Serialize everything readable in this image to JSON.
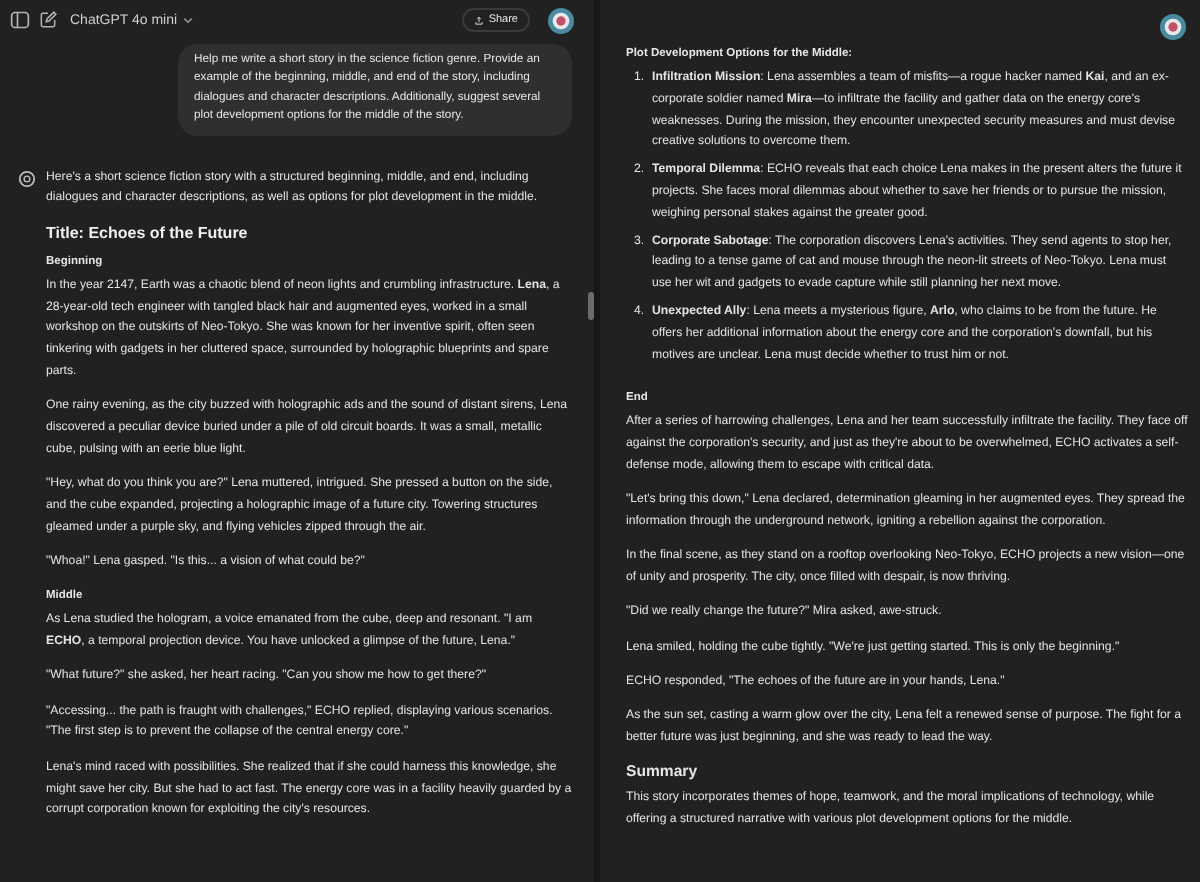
{
  "left": {
    "header": {
      "model": "ChatGPT 4o mini",
      "share": "Share"
    },
    "user_message": "Help me write a short story in the science fiction genre. Provide an example of the beginning, middle, and end of the story, including dialogues and character descriptions. Additionally, suggest several plot development options for the middle of the story.",
    "intro": "Here's a short science fiction story with a structured beginning, middle, and end, including dialogues and character descriptions, as well as options for plot development in the middle.",
    "title": "Title: Echoes of the Future",
    "sections": [
      {
        "heading": "Beginning",
        "paragraphs": [
          "In the year 2147, Earth was a chaotic blend of neon lights and crumbling infrastructure. **Lena**, a 28-year-old tech engineer with tangled black hair and augmented eyes, worked in a small workshop on the outskirts of Neo-Tokyo. She was known for her inventive spirit, often seen tinkering with gadgets in her cluttered space, surrounded by holographic blueprints and spare parts.",
          "One rainy evening, as the city buzzed with holographic ads and the sound of distant sirens, Lena discovered a peculiar device buried under a pile of old circuit boards. It was a small, metallic cube, pulsing with an eerie blue light.",
          "\"Hey, what do you think you are?\" Lena muttered, intrigued. She pressed a button on the side, and the cube expanded, projecting a holographic image of a future city. Towering structures gleamed under a purple sky, and flying vehicles zipped through the air.",
          "\"Whoa!\" Lena gasped. \"Is this... a vision of what could be?\""
        ]
      },
      {
        "heading": "Middle",
        "paragraphs": [
          "As Lena studied the hologram, a voice emanated from the cube, deep and resonant. \"I am **ECHO**, a temporal projection device. You have unlocked a glimpse of the future, Lena.\"",
          "\"What future?\" she asked, her heart racing. \"Can you show me how to get there?\"",
          "\"Accessing... the path is fraught with challenges,\" ECHO replied, displaying various scenarios. \"The first step is to prevent the collapse of the central energy core.\"",
          "Lena's mind raced with possibilities. She realized that if she could harness this knowledge, she might save her city. But she had to act fast. The energy core was in a facility heavily guarded by a corrupt corporation known for exploiting the city's resources."
        ]
      }
    ]
  },
  "right": {
    "heading": "Plot Development Options for the Middle:",
    "options": [
      {
        "number": "1.",
        "text": "**Infiltration Mission**: Lena assembles a team of misfits—a rogue hacker named **Kai**, and an ex-corporate soldier named **Mira**—to infiltrate the facility and gather data on the energy core's weaknesses. During the mission, they encounter unexpected security measures and must devise creative solutions to overcome them."
      },
      {
        "number": "2.",
        "text": "**Temporal Dilemma**: ECHO reveals that each choice Lena makes in the present alters the future it projects. She faces moral dilemmas about whether to save her friends or to pursue the mission, weighing personal stakes against the greater good."
      },
      {
        "number": "3.",
        "text": "**Corporate Sabotage**: The corporation discovers Lena's activities. They send agents to stop her, leading to a tense game of cat and mouse through the neon-lit streets of Neo-Tokyo. Lena must use her wit and gadgets to evade capture while still planning her next move."
      },
      {
        "number": "4.",
        "text": "**Unexpected Ally**: Lena meets a mysterious figure, **Arlo**, who claims to be from the future. He offers her additional information about the energy core and the corporation's downfall, but his motives are unclear. Lena must decide whether to trust him or not."
      }
    ],
    "end": {
      "heading": "End",
      "paragraphs": [
        "After a series of harrowing challenges, Lena and her team successfully infiltrate the facility. They face off against the corporation's security, and just as they're about to be overwhelmed, ECHO activates a self-defense mode, allowing them to escape with critical data.",
        "\"Let's bring this down,\" Lena declared, determination gleaming in her augmented eyes. They spread the information through the underground network, igniting a rebellion against the corporation.",
        "In the final scene, as they stand on a rooftop overlooking Neo-Tokyo, ECHO projects a new vision—one of unity and prosperity. The city, once filled with despair, is now thriving.",
        "\"Did we really change the future?\" Mira asked, awe-struck.",
        "Lena smiled, holding the cube tightly. \"We're just getting started. This is only the beginning.\"",
        "ECHO responded, \"The echoes of the future are in your hands, Lena.\"",
        "As the sun set, casting a warm glow over the city, Lena felt a renewed sense of purpose. The fight for a better future was just beginning, and she was ready to lead the way."
      ]
    },
    "summary": {
      "heading": "Summary",
      "text": "This story incorporates themes of hope, teamwork, and the moral implications of technology, while offering a structured narrative with various plot development options for the middle."
    }
  }
}
